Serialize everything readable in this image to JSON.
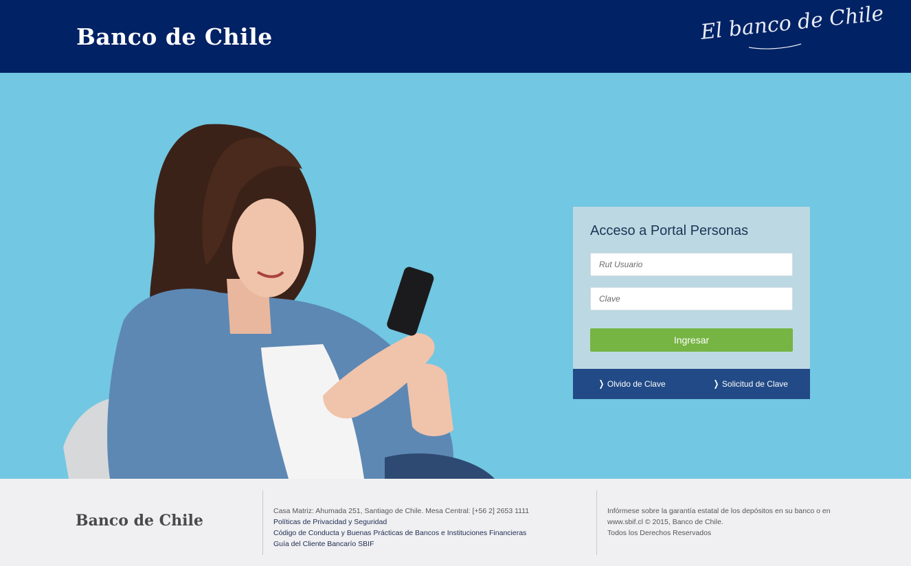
{
  "header": {
    "logo": "Banco de Chile",
    "slogan": "El banco de Chile",
    "bg_color": "#012265"
  },
  "hero": {
    "bg_color": "#72c7e2",
    "image": "woman-smiling-with-phone"
  },
  "login": {
    "title": "Acceso a Portal Personas",
    "rut_placeholder": "Rut Usuario",
    "clave_placeholder": "Clave",
    "rut_value": "",
    "clave_value": "",
    "submit_label": "Ingresar",
    "submit_color": "#76b443",
    "forgot_label": "Olvido de Clave",
    "request_label": "Solicitud de Clave",
    "links_bg": "#214a86",
    "chevron_icon": "chevron-right-icon"
  },
  "footer": {
    "logo": "Banco de Chile",
    "address": "Casa Matriz: Ahumada 251, Santiago de Chile. Mesa Central: [+56 2] 2653 1111",
    "links": [
      "Políticas de Privacidad y Seguridad",
      "Código de Conducta y Buenas Prácticas de Bancos e Instituciones Financieras",
      "Guía del Cliente Bancarío SBIF"
    ],
    "right_lines": [
      "Infórmese sobre la garantía estatal de los depósitos en su banco o en",
      "www.sbif.cl © 2015, Banco de Chile.",
      "Todos los Derechos Reservados"
    ]
  }
}
